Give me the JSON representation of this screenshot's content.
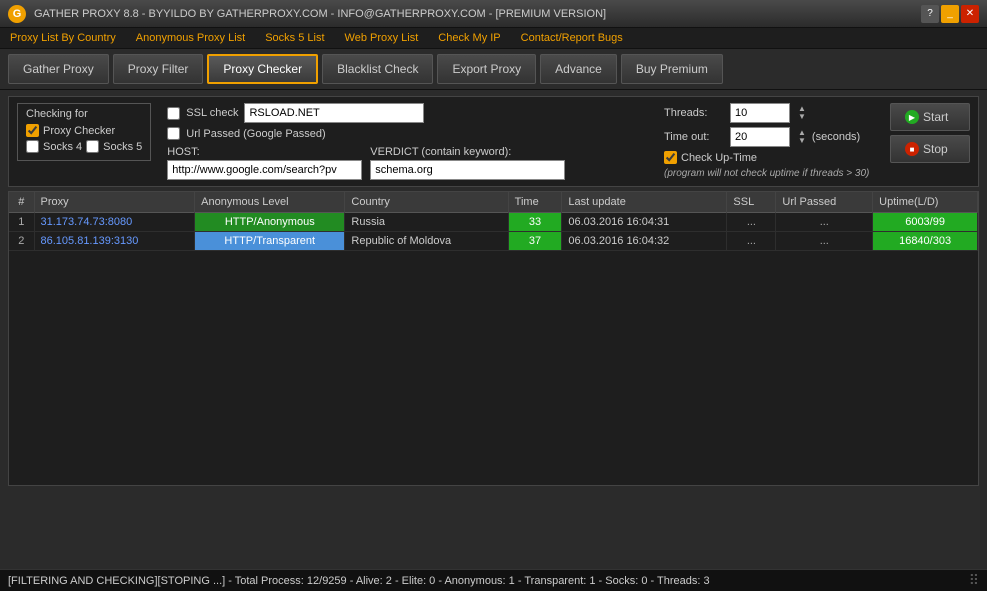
{
  "titlebar": {
    "icon": "G",
    "title": "GATHER PROXY 8.8 - BYYILDO BY GATHERPROXY.COM - INFO@GATHERPROXY.COM - [PREMIUM VERSION]",
    "help_btn": "?",
    "minimize_btn": "_",
    "close_btn": "✕"
  },
  "nav": {
    "items": [
      {
        "label": "Proxy List By Country",
        "id": "proxy-list-by-country"
      },
      {
        "label": "Anonymous Proxy List",
        "id": "anonymous-proxy-list"
      },
      {
        "label": "Socks 5 List",
        "id": "socks5-list"
      },
      {
        "label": "Web Proxy List",
        "id": "web-proxy-list"
      },
      {
        "label": "Check My IP",
        "id": "check-my-ip"
      },
      {
        "label": "Contact/Report Bugs",
        "id": "contact"
      }
    ]
  },
  "toolbar": {
    "buttons": [
      {
        "label": "Gather Proxy",
        "id": "gather-proxy",
        "active": false
      },
      {
        "label": "Proxy Filter",
        "id": "proxy-filter",
        "active": false
      },
      {
        "label": "Proxy Checker",
        "id": "proxy-checker",
        "active": true
      },
      {
        "label": "Blacklist Check",
        "id": "blacklist-check",
        "active": false
      },
      {
        "label": "Export Proxy",
        "id": "export-proxy",
        "active": false
      },
      {
        "label": "Advance",
        "id": "advance",
        "active": false
      },
      {
        "label": "Buy Premium",
        "id": "buy-premium",
        "active": false
      }
    ]
  },
  "options": {
    "checking_for_label": "Checking for",
    "proxy_checker_label": "Proxy Checker",
    "socks4_label": "Socks 4",
    "socks5_label": "Socks 5",
    "ssl_check_label": "SSL check",
    "ssl_host": "RSLOAD.NET",
    "url_passed_label": "Url Passed (Google Passed)",
    "host_label": "HOST:",
    "host_value": "http://www.google.com/search?pv",
    "verdict_label": "VERDICT (contain keyword):",
    "verdict_value": "schema.org",
    "threads_label": "Threads:",
    "threads_value": "10",
    "timeout_label": "Time out:",
    "timeout_value": "20",
    "seconds_label": "(seconds)",
    "check_uptime_label": "Check Up-Time",
    "uptime_note": "(program will not check uptime if threads > 30)",
    "start_label": "Start",
    "stop_label": "Stop"
  },
  "table": {
    "columns": [
      "#",
      "Proxy",
      "Anonymous Level",
      "Country",
      "Time",
      "Last update",
      "SSL",
      "Url Passed",
      "Uptime(L/D)"
    ],
    "rows": [
      {
        "num": "1",
        "proxy": "31.173.74.73:8080",
        "anon": "HTTP/Anonymous",
        "anon_type": "anonymous",
        "country": "Russia",
        "time": "33",
        "last_update": "06.03.2016 16:04:31",
        "ssl": "...",
        "url_passed": "...",
        "uptime": "6003/99"
      },
      {
        "num": "2",
        "proxy": "86.105.81.139:3130",
        "anon": "HTTP/Transparent",
        "anon_type": "transparent",
        "country": "Republic of Moldova",
        "time": "37",
        "last_update": "06.03.2016 16:04:32",
        "ssl": "...",
        "url_passed": "...",
        "uptime": "16840/303"
      }
    ]
  },
  "statusbar": {
    "text": "[FILTERING AND CHECKING][STOPING ...] - Total Process: 12/9259 - Alive: 2 - Elite: 0 - Anonymous: 1 - Transparent: 1 - Socks: 0 - Threads: 3"
  }
}
